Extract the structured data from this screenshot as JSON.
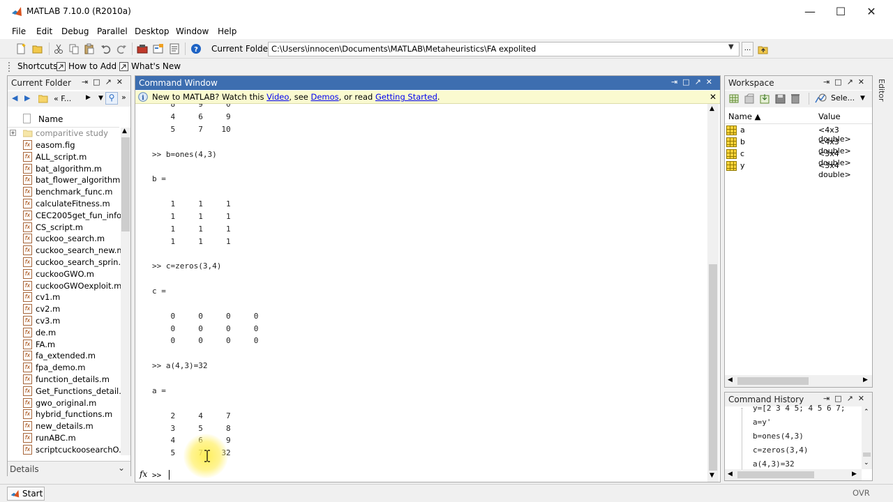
{
  "window": {
    "title": "MATLAB  7.10.0 (R2010a)",
    "minimize_glyph": "—",
    "maximize_glyph": "☐",
    "close_glyph": "✕"
  },
  "menu": [
    "File",
    "Edit",
    "Debug",
    "Parallel",
    "Desktop",
    "Window",
    "Help"
  ],
  "toolbar": {
    "current_folder_label": "Current Folder:",
    "current_folder_path": "C:\\Users\\innocen\\Documents\\MATLAB\\Metaheuristics\\FA expolited",
    "browse_label": "..."
  },
  "shortcuts": {
    "shortcuts_label": "Shortcuts",
    "how_to_add_label": "How to Add",
    "whats_new_label": "What's New"
  },
  "current_folder_panel": {
    "title": "Current Folder",
    "breadcrumb": "« F...",
    "name_header": "Name",
    "details_label": "Details",
    "folder": "comparitive study",
    "files": [
      "easom.fig",
      "ALL_script.m",
      "bat_algorithm.m",
      "bat_flower_algorithm...",
      "benchmark_func.m",
      "calculateFitness.m",
      "CEC2005get_fun_info...",
      "CS_script.m",
      "cuckoo_search.m",
      "cuckoo_search_new.m",
      "cuckoo_search_sprin...",
      "cuckooGWO.m",
      "cuckooGWOexploit.m",
      "cv1.m",
      "cv2.m",
      "cv3.m",
      "de.m",
      "FA.m",
      "fa_extended.m",
      "fpa_demo.m",
      "function_details.m",
      "Get_Functions_detail...",
      "gwo_original.m",
      "hybrid_functions.m",
      "new_details.m",
      "runABC.m",
      "scriptcuckoosearchO..."
    ]
  },
  "command_window": {
    "title": "Command Window",
    "banner_prefix": "New to MATLAB? Watch this ",
    "banner_video": "Video",
    "banner_see": ", see ",
    "banner_demos": "Demos",
    "banner_or": ", or read ",
    "banner_started": "Getting Started",
    "banner_end": ".",
    "lines": [
      "    4     6     9",
      "    5     7    10",
      "",
      ">> b=ones(4,3)",
      "",
      "b =",
      "",
      "    1     1     1",
      "    1     1     1",
      "    1     1     1",
      "    1     1     1",
      "",
      ">> c=zeros(3,4)",
      "",
      "c =",
      "",
      "    0     0     0     0",
      "    0     0     0     0",
      "    0     0     0     0",
      "",
      ">> a(4,3)=32",
      "",
      "a =",
      "",
      "    2     4     7",
      "    3     5     8",
      "    4     6     9",
      "    5     7    32"
    ],
    "fx_label": "fx",
    "prompt": ">>"
  },
  "workspace": {
    "title": "Workspace",
    "select_label": "Sele...",
    "name_header": "Name ▲",
    "value_header": "Value",
    "variables": [
      {
        "name": "a",
        "value": "<4x3 double>"
      },
      {
        "name": "b",
        "value": "<4x3 double>"
      },
      {
        "name": "c",
        "value": "<3x4 double>"
      },
      {
        "name": "y",
        "value": "<3x4 double>"
      }
    ]
  },
  "editor_tab": "Editor",
  "command_history": {
    "title": "Command History",
    "lines": [
      "y=[2 3 4 5; 4 5 6 7;",
      "a=y'",
      "b=ones(4,3)",
      "c=zeros(3,4)",
      "a(4,3)=32"
    ]
  },
  "statusbar": {
    "start_label": "Start",
    "ovr_label": "OVR"
  },
  "colors": {
    "active_title": "#3d6eb0",
    "banner_bg": "#fafad0",
    "link": "#0000ee"
  }
}
